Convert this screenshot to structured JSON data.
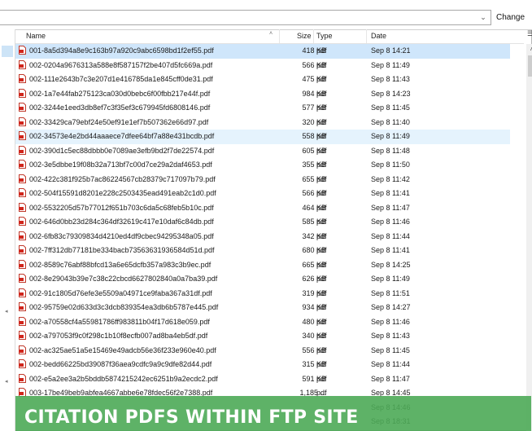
{
  "pathbar": {
    "value": "",
    "change_label_u": "Change",
    "dropdown_icon": "chevron-down-icon"
  },
  "columns": {
    "name": "Name",
    "size": "Size",
    "type": "Type",
    "date": "Date",
    "sort_icon": "sort-ascending-icon",
    "columns_icon": "column-options-icon"
  },
  "files": [
    {
      "name": "001-8a5d394a8e9c163b97a920c9abc6598bd1f2ef55.pdf",
      "size": "418 KB",
      "type": "pdf",
      "date": "Sep 8 14:21"
    },
    {
      "name": "002-0204a9676313a588e8f587157f2be407d5fc669a.pdf",
      "size": "566 KB",
      "type": "pdf",
      "date": "Sep 8 11:49"
    },
    {
      "name": "002-111e2643b7c3e207d1e416785da1e845cff0de31.pdf",
      "size": "475 KB",
      "type": "pdf",
      "date": "Sep 8 11:43"
    },
    {
      "name": "002-1a7e44fab275123ca030d0bebc6f00fbb217e44f.pdf",
      "size": "984 KB",
      "type": "pdf",
      "date": "Sep 8 14:23"
    },
    {
      "name": "002-3244e1eed3db8ef7c3f35ef3c679945fd6808146.pdf",
      "size": "577 KB",
      "type": "pdf",
      "date": "Sep 8 11:45"
    },
    {
      "name": "002-33429ca79ebf24e50ef91e1ef7b507362e66d97.pdf",
      "size": "320 KB",
      "type": "pdf",
      "date": "Sep 8 11:40"
    },
    {
      "name": "002-34573e4e2bd44aaaece7dfee64bf7a88e431bcdb.pdf",
      "size": "558 KB",
      "type": "pdf",
      "date": "Sep 8 11:49"
    },
    {
      "name": "002-390d1c5ec88dbbb0e7089ae3efb9bd2f7de22574.pdf",
      "size": "605 KB",
      "type": "pdf",
      "date": "Sep 8 11:48"
    },
    {
      "name": "002-3e5dbbe19f08b32a713bf7c00d7ce29a2daf4653.pdf",
      "size": "355 KB",
      "type": "pdf",
      "date": "Sep 8 11:50"
    },
    {
      "name": "002-422c381f925b7ac86224567cb28379c717097b79.pdf",
      "size": "655 KB",
      "type": "pdf",
      "date": "Sep 8 11:42"
    },
    {
      "name": "002-504f15591d8201e228c2503435ead491eab2c1d0.pdf",
      "size": "566 KB",
      "type": "pdf",
      "date": "Sep 8 11:41"
    },
    {
      "name": "002-5532205d57b77012f651b703c6da5c68feb5b10c.pdf",
      "size": "464 KB",
      "type": "pdf",
      "date": "Sep 8 11:47"
    },
    {
      "name": "002-646d0bb23d284c364df32619c417e10daf6c84db.pdf",
      "size": "585 KB",
      "type": "pdf",
      "date": "Sep 8 11:46"
    },
    {
      "name": "002-6fb83c79309834d4210ed4df9cbec94295348a05.pdf",
      "size": "342 KB",
      "type": "pdf",
      "date": "Sep 8 11:44"
    },
    {
      "name": "002-7ff312db77181be334bacb73563631936584d51d.pdf",
      "size": "680 KB",
      "type": "pdf",
      "date": "Sep 8 11:41"
    },
    {
      "name": "002-8589c76abf88bfcd13a6e65dcfb357a983c3b9ec.pdf",
      "size": "665 KB",
      "type": "pdf",
      "date": "Sep 8 14:25"
    },
    {
      "name": "002-8e29043b39e7c38c22cbcd6627802840a0a7ba39.pdf",
      "size": "626 KB",
      "type": "pdf",
      "date": "Sep 8 11:49"
    },
    {
      "name": "002-91c1805d76efe3e5509a04971ce9faba367a31df.pdf",
      "size": "319 KB",
      "type": "pdf",
      "date": "Sep 8 11:51"
    },
    {
      "name": "002-95759e02d633d3c3dcb839354ea3db6b5787e445.pdf",
      "size": "934 KB",
      "type": "pdf",
      "date": "Sep 8 14:27"
    },
    {
      "name": "002-a70558cf4a55981786ff983811b04f17d618e059.pdf",
      "size": "480 KB",
      "type": "pdf",
      "date": "Sep 8 11:46"
    },
    {
      "name": "002-a797053f9c0f298c1b10f8ecfb007ad8ba4eb5df.pdf",
      "size": "340 KB",
      "type": "pdf",
      "date": "Sep 8 11:43"
    },
    {
      "name": "002-ac325ae51a5e15469e49adcb56e36f233e960e40.pdf",
      "size": "556 KB",
      "type": "pdf",
      "date": "Sep 8 11:45"
    },
    {
      "name": "002-bedd66225bd39087f36aea9cdfc9a9c9dfe82d44.pdf",
      "size": "315 KB",
      "type": "pdf",
      "date": "Sep 8 11:44"
    },
    {
      "name": "002-e5a2ee3a2b5bddb5874215242ec6251b9a2ecdc2.pdf",
      "size": "591 KB",
      "type": "pdf",
      "date": "Sep 8 11:47"
    },
    {
      "name": "003-17be49beb9abfea4667abbe6e78fdec56f2e7388.pdf",
      "size": "1,185 ...",
      "type": "pdf",
      "date": "Sep 8 14:45"
    },
    {
      "name": "",
      "size": "",
      "type": "",
      "date": "Sep 8 14:46"
    },
    {
      "name": "",
      "size": "",
      "type": "",
      "date": "Sep 8 18:31"
    }
  ],
  "selected_index": 0,
  "highlight_index": 6,
  "banner": {
    "text": "CITATION PDFS WITHIN FTP SITE",
    "color": "#4caa56"
  },
  "pdf_icon": "pdf-file-icon",
  "accent": "#cfe6fb"
}
